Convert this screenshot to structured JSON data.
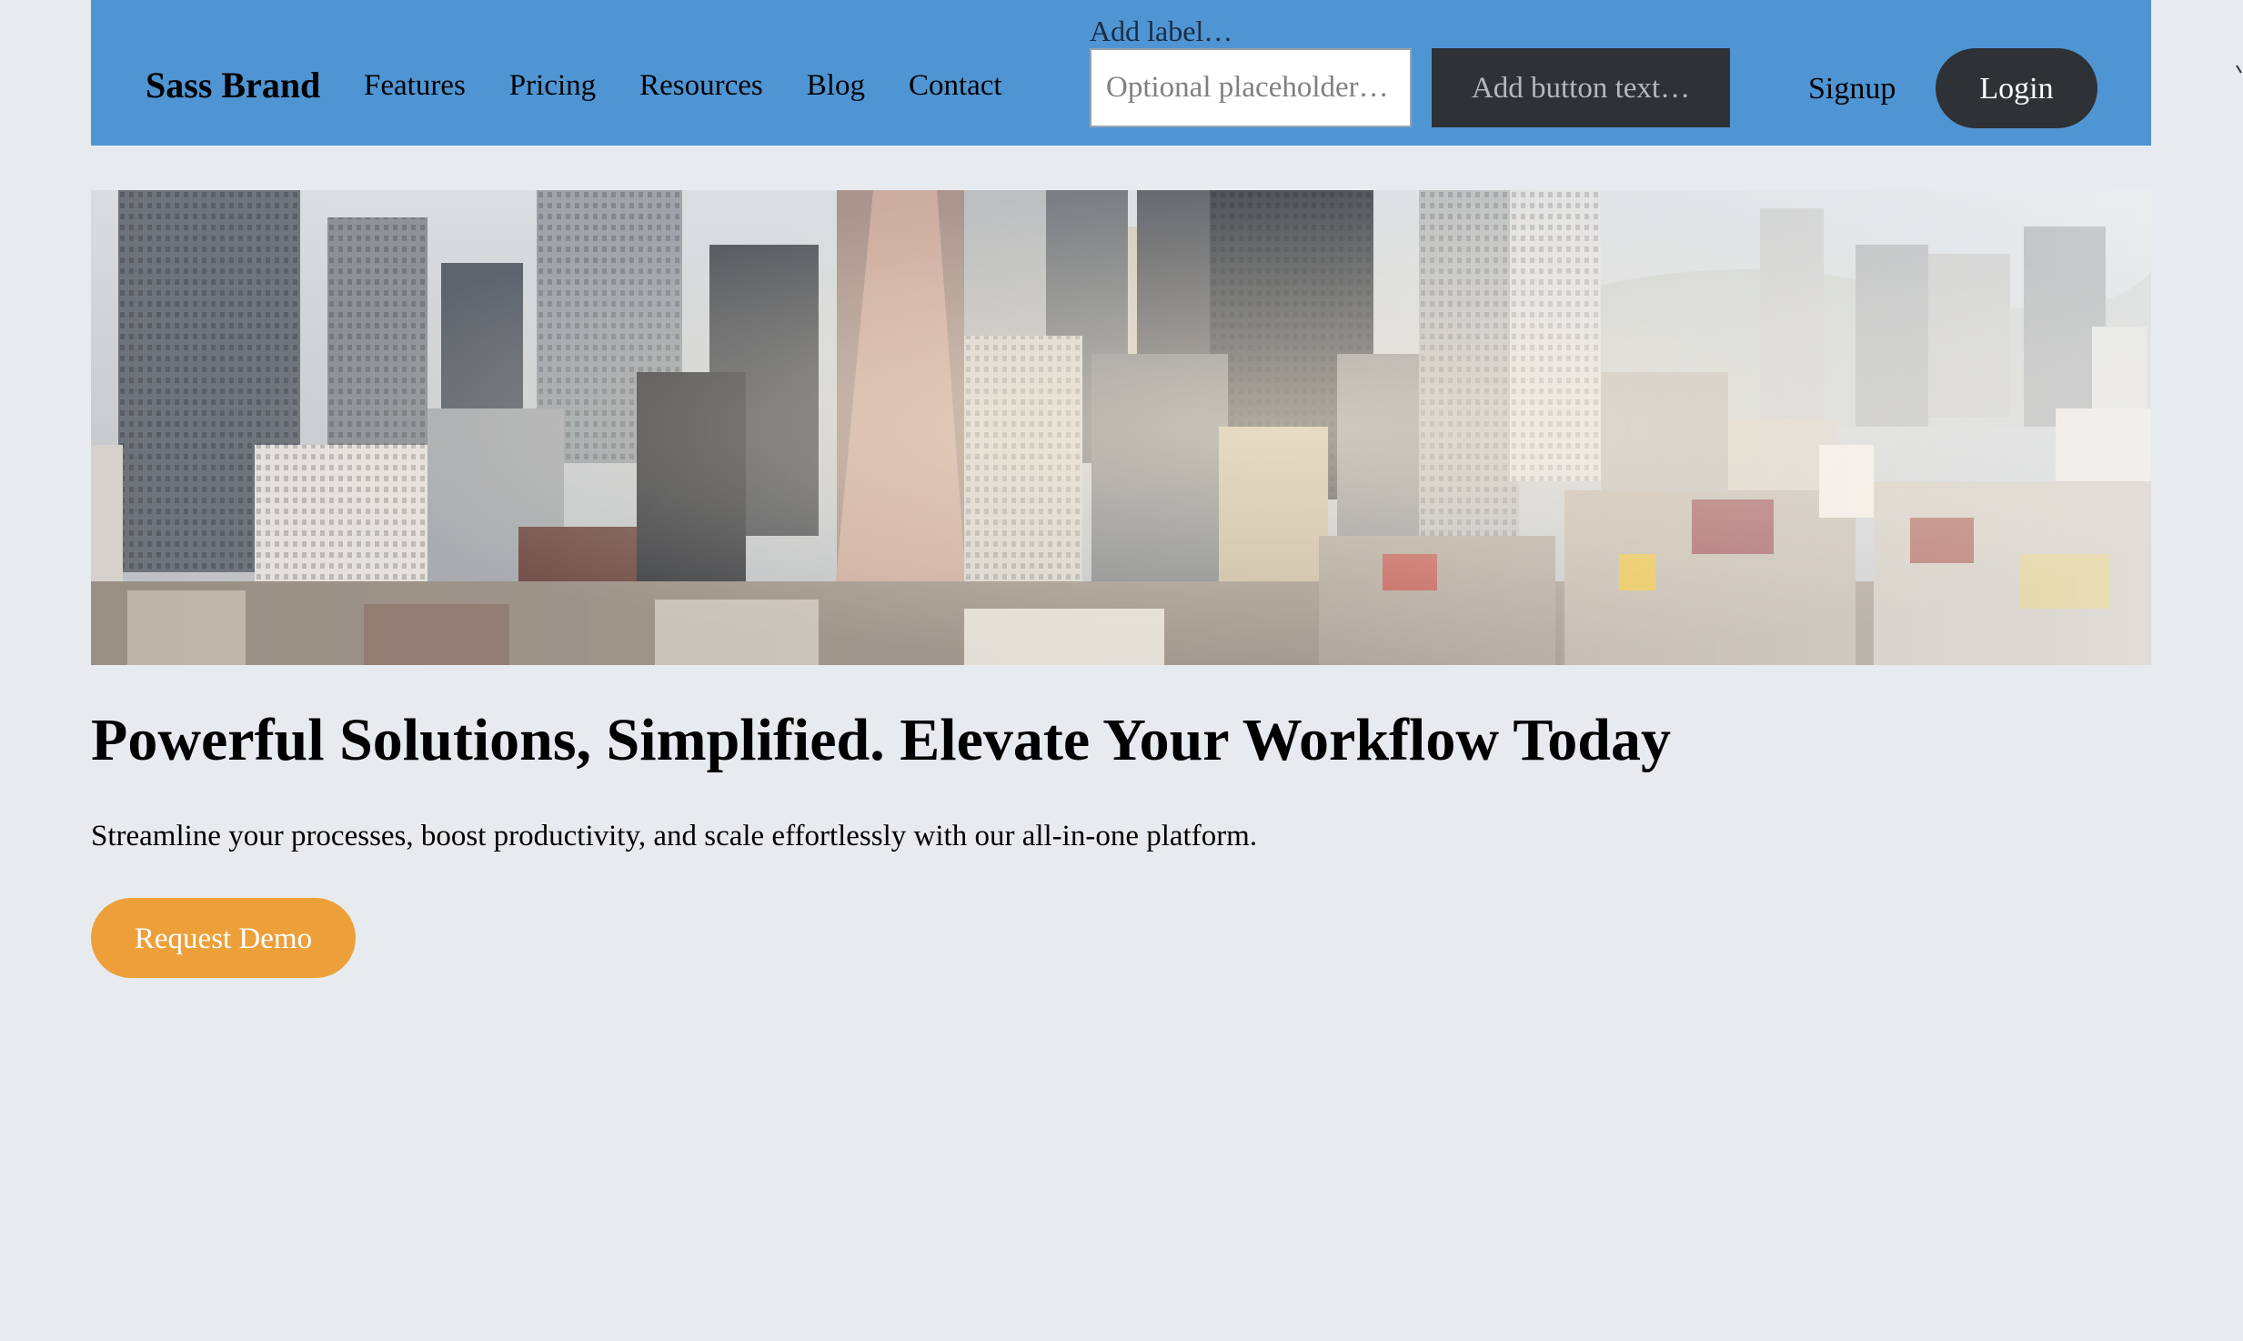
{
  "navbar": {
    "brand": "Sass Brand",
    "links": [
      "Features",
      "Pricing",
      "Resources",
      "Blog",
      "Contact"
    ],
    "field_label": "Add label…",
    "input_placeholder": "Optional placeholder…",
    "action_button": "Add button text…",
    "signup": "Signup",
    "login": "Login"
  },
  "hero": {
    "image_icon": "city-skyline-photo",
    "headline": "Powerful Solutions, Simplified. Elevate Your Workflow Today",
    "subtext": "Streamline your processes, boost productivity, and scale effortlessly with our all-in-one platform.",
    "cta": "Request Demo"
  },
  "colors": {
    "background": "#e7ebef",
    "navbar": "#4f95d4",
    "dark_button": "#2e3136",
    "accent": "#eda03a"
  }
}
